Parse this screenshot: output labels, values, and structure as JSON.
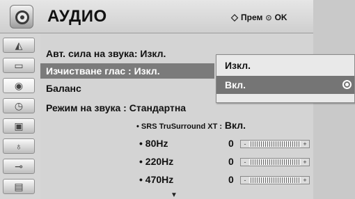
{
  "header": {
    "title": "АУДИО",
    "hint_move": "Прем",
    "hint_ok": "OK",
    "icon": "audio-speaker-icon"
  },
  "sidebar": {
    "items": [
      {
        "icon": "picture-icon"
      },
      {
        "icon": "screen-icon"
      },
      {
        "icon": "audio-icon",
        "active": true
      },
      {
        "icon": "time-icon"
      },
      {
        "icon": "lock-icon"
      },
      {
        "icon": "option-icon"
      },
      {
        "icon": "input-icon"
      },
      {
        "icon": "usb-icon"
      }
    ]
  },
  "menu": {
    "auto_volume": "Авт. сила на звука: Изкл.",
    "clear_voice": "Изчистване глас   : Изкл.",
    "balance": "Баланс",
    "sound_mode": "Режим на звука  : Стандартна",
    "srs_label": "• SRS TruSurround XT :",
    "srs_value": "Вкл.",
    "eq": [
      {
        "label": "• 80Hz",
        "value": "0",
        "slider_min": "-",
        "slider_max": "+"
      },
      {
        "label": "• 220Hz",
        "value": "0",
        "slider_min": "-",
        "slider_max": "+"
      },
      {
        "label": "• 470Hz",
        "value": "0",
        "slider_min": "-",
        "slider_max": "+"
      }
    ]
  },
  "popup": {
    "options": [
      {
        "label": "Изкл.",
        "selected": false
      },
      {
        "label": "Вкл.",
        "selected": true
      }
    ]
  },
  "colors": {
    "selected_row": "#7b7b7b",
    "panel_bg": "#d4d4d4"
  }
}
